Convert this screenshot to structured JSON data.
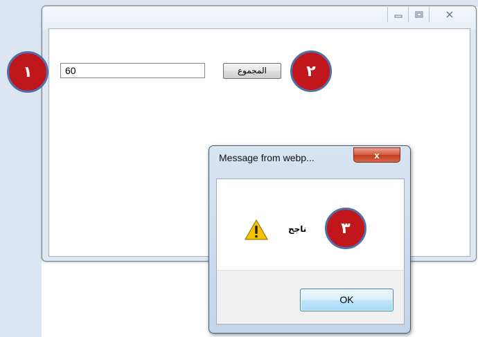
{
  "form": {
    "input_value": "60",
    "sum_button_label": "المجموع"
  },
  "window": {
    "controls": {
      "minimize_icon": "minimize-icon",
      "restore_icon": "restore-icon",
      "close_icon": "close-icon"
    }
  },
  "dialog": {
    "title": "Message from webp...",
    "close_label": "x",
    "message": "ناجح",
    "icon": "warning-icon",
    "ok_label": "OK"
  },
  "callouts": [
    {
      "label": "١"
    },
    {
      "label": "٢"
    },
    {
      "label": "٣"
    }
  ],
  "colors": {
    "callout_fill": "#c0161c",
    "callout_border": "#4f6fa8",
    "close_button": "#c23a1d",
    "warning": "#f2c200"
  }
}
